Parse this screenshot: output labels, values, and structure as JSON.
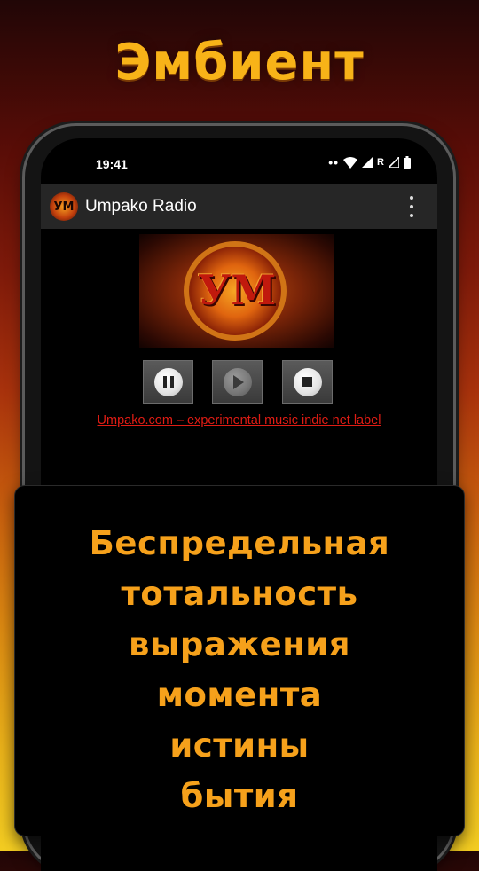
{
  "headline": "Эмбиент",
  "status_bar": {
    "time": "19:41",
    "r_label": "R"
  },
  "app_bar": {
    "logo_text": "УМ",
    "title": "Umpako Radio"
  },
  "banner": {
    "logo_text": "УМ"
  },
  "controls": {
    "buttons": [
      "pause",
      "play",
      "stop"
    ]
  },
  "link": {
    "text": "Umpako.com – experimental music indie net label"
  },
  "caption": {
    "lines": [
      "Беспредельная",
      "тотальность",
      "выражения",
      "момента",
      "истины",
      "бытия"
    ]
  },
  "colors": {
    "accent": "#f6a11b",
    "link": "#e01c14"
  }
}
